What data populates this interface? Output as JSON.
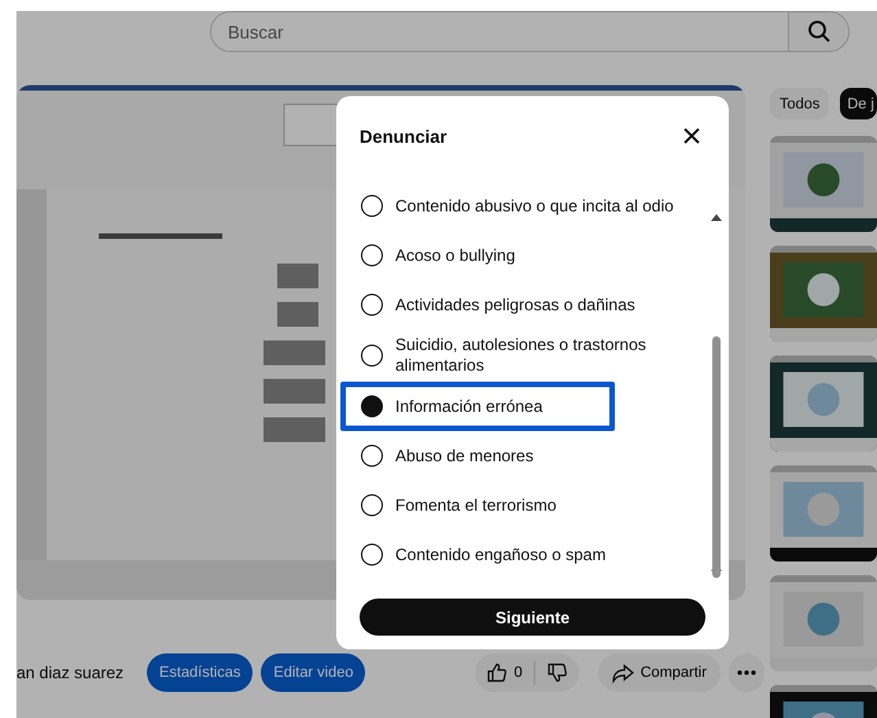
{
  "search": {
    "placeholder": "Buscar"
  },
  "sidebar": {
    "chips": [
      {
        "label": "Todos",
        "selected": false
      },
      {
        "label": "De j",
        "selected": true
      }
    ]
  },
  "channel": {
    "name": "an diaz suarez"
  },
  "actions": {
    "buttons": [
      "Estadísticas",
      "Editar video"
    ],
    "likes": "0",
    "share": "Compartir"
  },
  "dialog": {
    "title": "Denunciar",
    "options": [
      {
        "label": "Contenido abusivo o que incita al odio",
        "selected": false
      },
      {
        "label": "Acoso o bullying",
        "selected": false
      },
      {
        "label": "Actividades peligrosas o dañinas",
        "selected": false
      },
      {
        "label": "Suicidio, autolesiones o trastornos alimentarios",
        "selected": false
      },
      {
        "label": "Información errónea",
        "selected": true
      },
      {
        "label": "Abuso de menores",
        "selected": false
      },
      {
        "label": "Fomenta el terrorismo",
        "selected": false
      },
      {
        "label": "Contenido engañoso o spam",
        "selected": false
      }
    ],
    "button": "Siguiente"
  }
}
